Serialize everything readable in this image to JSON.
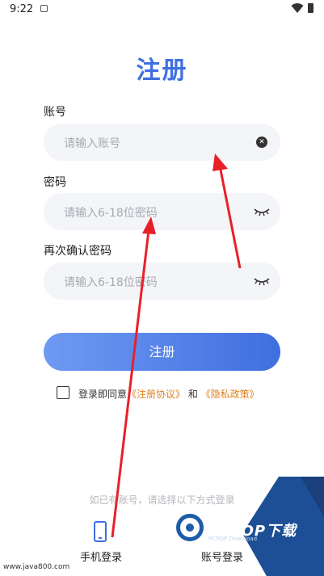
{
  "status_bar": {
    "time": "9:22"
  },
  "page": {
    "title": "注册"
  },
  "form": {
    "account": {
      "label": "账号",
      "placeholder": "请输入账号"
    },
    "password": {
      "label": "密码",
      "placeholder": "请输入6-18位密码"
    },
    "confirm": {
      "label": "再次确认密码",
      "placeholder": "请输入6-18位密码"
    },
    "submit_label": "注册",
    "agreement": {
      "prefix": "登录即同意",
      "terms": "《注册协议》",
      "and": " 和 ",
      "privacy": "《隐私政策》"
    }
  },
  "alt_login": {
    "hint": "如已有账号，请选择以下方式登录",
    "options": [
      {
        "label": "手机登录",
        "icon": "phone-icon"
      },
      {
        "label": "账号登录",
        "icon": "account-icon"
      }
    ]
  },
  "watermark": {
    "site": "www.java800.com",
    "brand": "PCPOP下载",
    "sub": "PCPOP Download"
  },
  "colors": {
    "accent": "#3f6fe0",
    "link": "#e0801e",
    "arrow": "#e8202a",
    "field_bg": "#f4f5f8"
  }
}
